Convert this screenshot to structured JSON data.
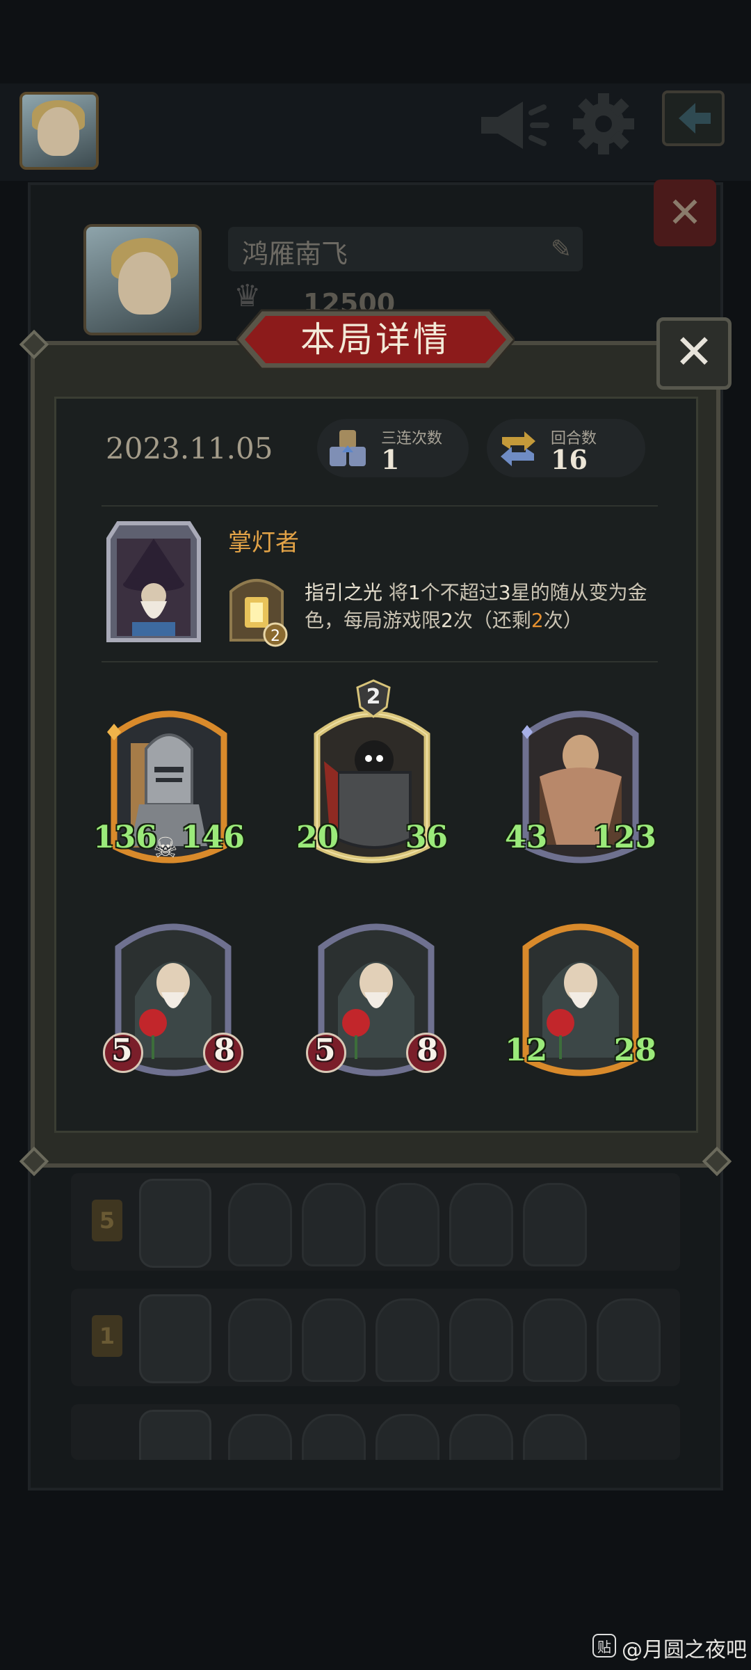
{
  "player": {
    "name": "鸿雁南飞",
    "score": "12500"
  },
  "modal": {
    "title": "本局详情",
    "date": "2023.11.05",
    "stats": [
      {
        "label": "三连次数",
        "value": "1"
      },
      {
        "label": "回合数",
        "value": "16"
      }
    ],
    "hero": {
      "name": "掌灯者",
      "skill_name": "指引之光",
      "skill_desc_1": " 将",
      "skill_num_1": "1",
      "skill_desc_2": "个不超过",
      "skill_num_2": "3",
      "skill_desc_3": "星的随从变为金色，每局游戏限",
      "skill_num_3": "2",
      "skill_desc_4": "次（还剩",
      "skill_num_4": "2",
      "skill_desc_5": "次）",
      "charges": "2"
    },
    "units": [
      {
        "name": "knight",
        "attack": "136",
        "health": "146",
        "frame": "gold",
        "stat_color": "green"
      },
      {
        "name": "shield-goblin",
        "attack": "20",
        "health": "36",
        "frame": "glow",
        "stat_color": "green",
        "level": "2"
      },
      {
        "name": "brute",
        "attack": "43",
        "health": "123",
        "frame": "silver",
        "stat_color": "green"
      },
      {
        "name": "rose-monk",
        "attack": "5",
        "health": "8",
        "frame": "silver",
        "stat_color": "white"
      },
      {
        "name": "rose-monk",
        "attack": "5",
        "health": "8",
        "frame": "silver",
        "stat_color": "white"
      },
      {
        "name": "rose-monk",
        "attack": "12",
        "health": "28",
        "frame": "gold",
        "stat_color": "green"
      }
    ]
  },
  "history": [
    {
      "rank": "5"
    },
    {
      "rank": "1"
    }
  ],
  "watermark": "@月圆之夜吧",
  "watermark_icon": "贴",
  "colors": {
    "gold_frame": "#d98a2b",
    "silver_frame": "#6f7190",
    "green_stat": "#9bea7a",
    "title_red": "#8c1b1b",
    "hero_name": "#e3a347",
    "skill_highlight": "#e8912f"
  }
}
